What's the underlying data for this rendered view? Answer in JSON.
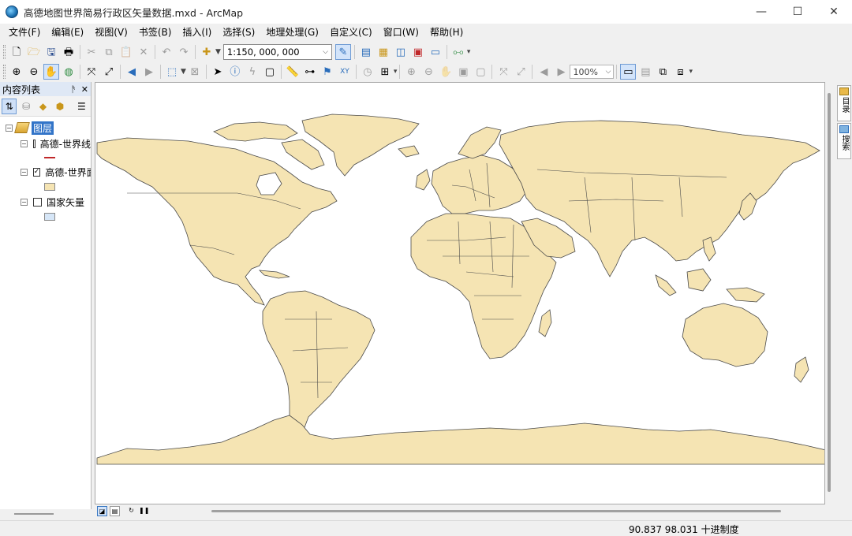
{
  "window": {
    "title": "高德地图世界简易行政区矢量数据.mxd - ArcMap",
    "controls": [
      "—",
      "☐",
      "✕"
    ]
  },
  "menu": [
    "文件(F)",
    "编辑(E)",
    "视图(V)",
    "书签(B)",
    "插入(I)",
    "选择(S)",
    "地理处理(G)",
    "自定义(C)",
    "窗口(W)",
    "帮助(H)"
  ],
  "toolbar": {
    "scale_value": "1:150, 000, 000",
    "zoom_value": "100%"
  },
  "toc": {
    "title": "内容列表",
    "pin_glyph": "ᚫ",
    "close_glyph": "✕",
    "group_label": "图层",
    "layers": [
      {
        "label": "高德-世界线",
        "checked": false,
        "symbol": "line",
        "color": "#c0282a"
      },
      {
        "label": "高德-世界面",
        "checked": true,
        "symbol": "polygon",
        "color": "#f5e4b3"
      },
      {
        "label": "国家矢量",
        "checked": false,
        "symbol": "polygon",
        "color": "#d6e6f7"
      }
    ]
  },
  "map": {
    "land_color": "#f5e4b3",
    "border_color": "#4a4a4a",
    "background": "#ffffff"
  },
  "status": {
    "coordinates": "90.837  98.031 十进制度"
  },
  "right_dock": [
    "目录",
    "搜索"
  ]
}
